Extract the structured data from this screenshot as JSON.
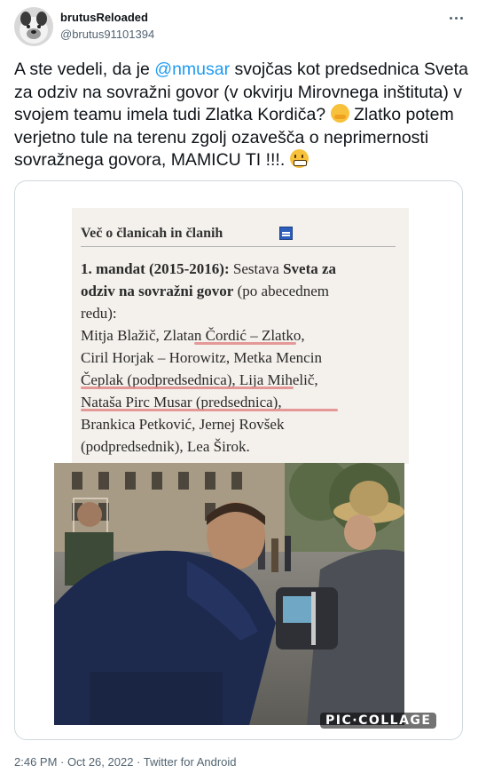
{
  "author": {
    "name": "brutusReloaded",
    "handle": "@brutus91101394"
  },
  "tweet": {
    "text_part1": "A ste vedeli, da je ",
    "mention": "@nmusar",
    "text_part2": " svojčas kot predsednica Sveta za odziv na sovražni govor (v okvirju Mirovnega inštituta) v svojem teamu imela tudi Zlatka Kordiča? ",
    "text_part3": " Zlatko potem verjetno tule na terenu zgolj ozaveščа o neprimernosti sovražnega govora,  MAMICU TI !!!. ",
    "emoji_1": "hugging-face-emoji",
    "emoji_2": "grimacing-face-emoji"
  },
  "media": {
    "document": {
      "heading": "Več o članicah in članih",
      "lines": [
        [
          "1. mandat (2015-2016):",
          " Sestava ",
          "Sveta za"
        ],
        [
          "odziv na sovražni govor",
          " (po abecednem",
          ""
        ],
        [
          "redu):",
          "",
          ""
        ],
        [
          "Mitja Blažič, Zlatan Čordić – Zlatko,",
          "",
          ""
        ],
        [
          "Ciril Horjak – Horowitz, Metka Mencin",
          "",
          ""
        ],
        [
          "Čeplak (podpredsednica), Lija Mihelič,",
          "",
          ""
        ],
        [
          "Nataša Pirc Musar (predsednica),",
          "",
          ""
        ],
        [
          "Brankica Petković, Jernej Rovšek",
          "",
          ""
        ],
        [
          "(podpredsednik), Lea Širok.",
          "",
          ""
        ]
      ]
    },
    "watermark": "PIC·COLLAGE"
  },
  "footer": {
    "time": "2:46 PM",
    "separator": " · ",
    "date": "Oct 26, 2022",
    "source": "Twitter for Android"
  },
  "colors": {
    "link": "#1d9bf0",
    "secondary_text": "#536471",
    "border": "#cfd9de"
  }
}
